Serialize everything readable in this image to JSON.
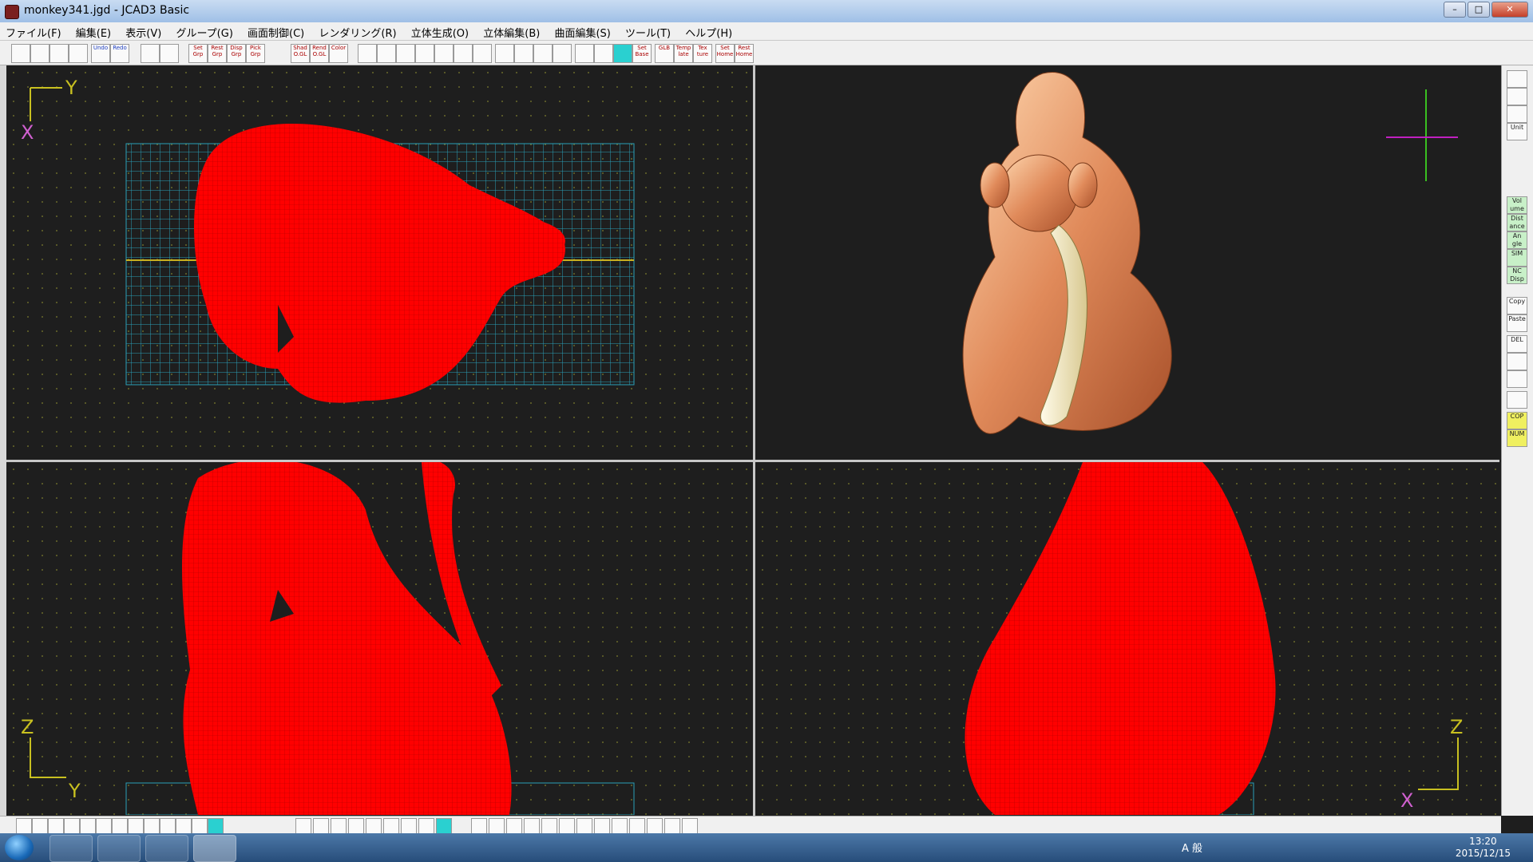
{
  "window": {
    "title": "monkey341.jgd - JCAD3 Basic",
    "min": "–",
    "max": "□",
    "close": "✕"
  },
  "menu": [
    "ファイル(F)",
    "編集(E)",
    "表示(V)",
    "グループ(G)",
    "画面制御(C)",
    "レンダリング(R)",
    "立体生成(O)",
    "立体編集(B)",
    "曲面編集(S)",
    "ツール(T)",
    "ヘルプ(H)"
  ],
  "toolbar": {
    "undo": "Undo",
    "redo": "Redo",
    "set_grp": "Set Grp",
    "rest_grp": "Rest Grp",
    "disp_grp": "Disp Grp",
    "pick_grp": "Pick Grp",
    "shad_ogl": "Shad O.GL",
    "rend_ogl": "Rend O.GL",
    "color": "Color",
    "set_base": "Set Base",
    "glb": "GLB",
    "template": "Temp late",
    "texture": "Tex ture",
    "set_home": "Set Home",
    "rest_home": "Rest Home"
  },
  "rightbar": {
    "unit": "Unit",
    "volume": "Vol ume",
    "distance": "Dist ance",
    "angle": "An gle",
    "sim": "SIM",
    "nc_disp": "NC Disp",
    "copy": "Copy",
    "paste": "Paste",
    "del": "DEL",
    "cop": "COP",
    "num": "NUM"
  },
  "views": {
    "top": {
      "axis_v": "Y",
      "axis_h": "X"
    },
    "front": {
      "axis_v": "Z",
      "axis_h": "Y"
    },
    "side": {
      "axis_v": "Z",
      "axis_h": "X"
    }
  },
  "taskbar": {
    "time": "13:20",
    "date": "2015/12/15",
    "ime": "A 般"
  },
  "colors": {
    "wire": "#ff0000",
    "grid": "#2aa0b8",
    "background": "#1e1e1e",
    "copper": "#e08a5a"
  }
}
